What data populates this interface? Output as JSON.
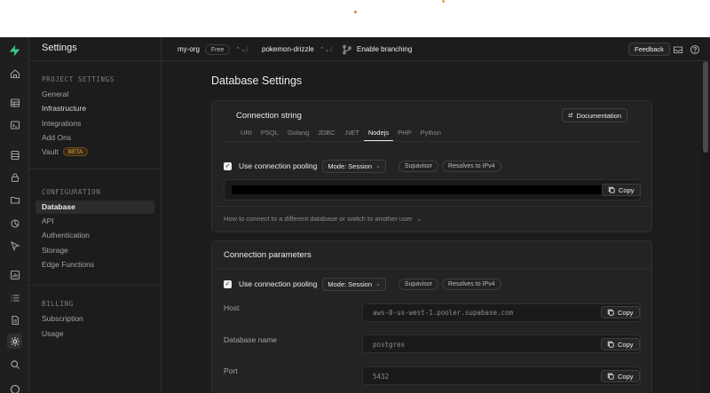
{
  "colors": {
    "background": "#1c1c1c",
    "brand": "#3ecf8e",
    "beta": "#e8a94b"
  },
  "rail": {
    "icons": [
      "home-icon",
      "table-editor-icon",
      "sql-editor-icon",
      "database-icon",
      "auth-icon",
      "storage-icon",
      "realtime-icon",
      "edge-functions-icon",
      "reports-icon",
      "logs-icon",
      "docs-icon",
      "settings-icon",
      "search-icon"
    ]
  },
  "sidebar": {
    "title": "Settings",
    "project_settings": {
      "heading": "PROJECT SETTINGS",
      "items": [
        "General",
        "Infrastructure",
        "Integrations",
        "Add Ons",
        "Vault"
      ],
      "vault_badge": "BETA"
    },
    "configuration": {
      "heading": "CONFIGURATION",
      "items": [
        "Database",
        "API",
        "Authentication",
        "Storage",
        "Edge Functions"
      ]
    },
    "billing": {
      "heading": "BILLING",
      "items": [
        "Subscription",
        "Usage"
      ]
    }
  },
  "header": {
    "org": "my-org",
    "plan": "Free",
    "project": "pokemon-drizzle",
    "branching": "Enable branching",
    "feedback": "Feedback"
  },
  "main": {
    "title": "Database Settings",
    "connection_string": {
      "title": "Connection string",
      "documentation": "Documentation",
      "tabs": [
        "URI",
        "PSQL",
        "Golang",
        "JDBC",
        ".NET",
        "Nodejs",
        "PHP",
        "Python"
      ],
      "active_tab": "Nodejs",
      "pooling_label": "Use connection pooling",
      "mode": "Mode: Session",
      "tags": [
        "Supavisor",
        "Resolves to IPv4"
      ],
      "copy": "Copy",
      "howto": "How to connect to a different database or switch to another user"
    },
    "connection_parameters": {
      "title": "Connection parameters",
      "pooling_label": "Use connection pooling",
      "mode": "Mode: Session",
      "tags": [
        "Supavisor",
        "Resolves to IPv4"
      ],
      "copy": "Copy",
      "params": [
        {
          "label": "Host",
          "value": "aws-0-us-west-1.pooler.supabase.com"
        },
        {
          "label": "Database name",
          "value": "postgres"
        },
        {
          "label": "Port",
          "value": "5432"
        }
      ]
    }
  }
}
